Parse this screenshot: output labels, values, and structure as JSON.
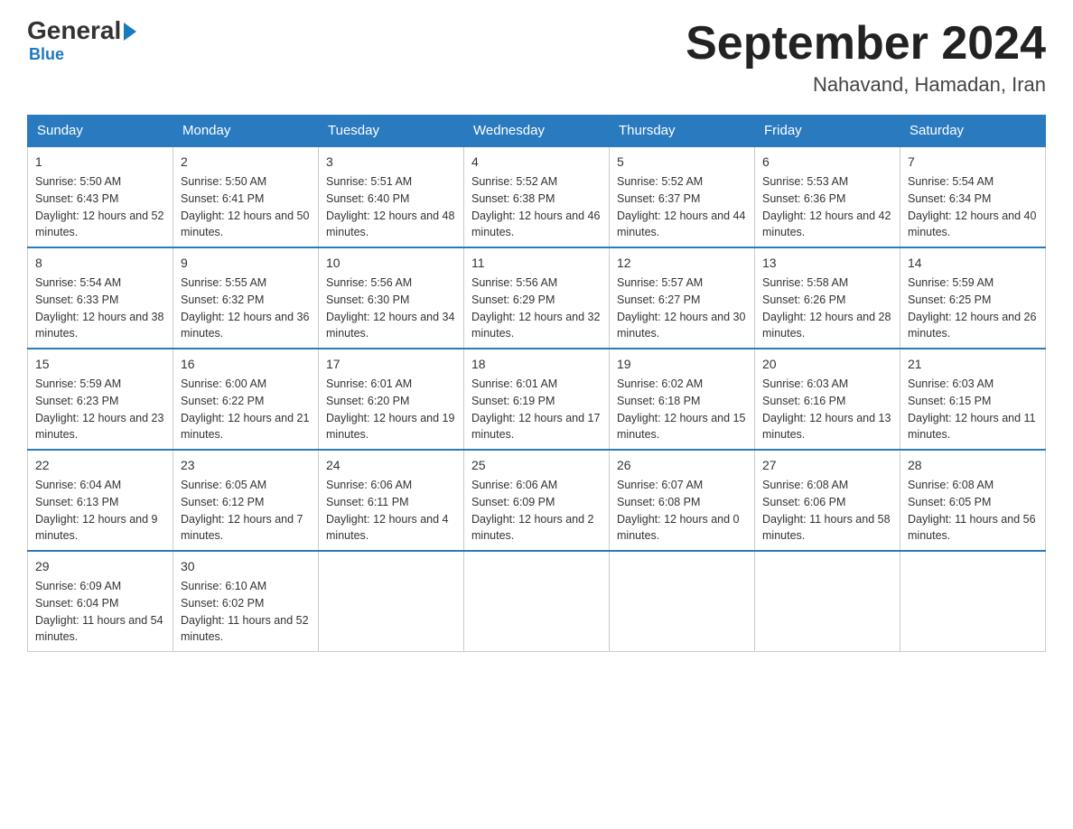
{
  "logo": {
    "general": "General",
    "blue": "Blue",
    "subtitle": "Blue"
  },
  "title": {
    "month_year": "September 2024",
    "location": "Nahavand, Hamadan, Iran"
  },
  "days_header": [
    "Sunday",
    "Monday",
    "Tuesday",
    "Wednesday",
    "Thursday",
    "Friday",
    "Saturday"
  ],
  "weeks": [
    [
      {
        "day": "1",
        "sunrise": "Sunrise: 5:50 AM",
        "sunset": "Sunset: 6:43 PM",
        "daylight": "Daylight: 12 hours and 52 minutes."
      },
      {
        "day": "2",
        "sunrise": "Sunrise: 5:50 AM",
        "sunset": "Sunset: 6:41 PM",
        "daylight": "Daylight: 12 hours and 50 minutes."
      },
      {
        "day": "3",
        "sunrise": "Sunrise: 5:51 AM",
        "sunset": "Sunset: 6:40 PM",
        "daylight": "Daylight: 12 hours and 48 minutes."
      },
      {
        "day": "4",
        "sunrise": "Sunrise: 5:52 AM",
        "sunset": "Sunset: 6:38 PM",
        "daylight": "Daylight: 12 hours and 46 minutes."
      },
      {
        "day": "5",
        "sunrise": "Sunrise: 5:52 AM",
        "sunset": "Sunset: 6:37 PM",
        "daylight": "Daylight: 12 hours and 44 minutes."
      },
      {
        "day": "6",
        "sunrise": "Sunrise: 5:53 AM",
        "sunset": "Sunset: 6:36 PM",
        "daylight": "Daylight: 12 hours and 42 minutes."
      },
      {
        "day": "7",
        "sunrise": "Sunrise: 5:54 AM",
        "sunset": "Sunset: 6:34 PM",
        "daylight": "Daylight: 12 hours and 40 minutes."
      }
    ],
    [
      {
        "day": "8",
        "sunrise": "Sunrise: 5:54 AM",
        "sunset": "Sunset: 6:33 PM",
        "daylight": "Daylight: 12 hours and 38 minutes."
      },
      {
        "day": "9",
        "sunrise": "Sunrise: 5:55 AM",
        "sunset": "Sunset: 6:32 PM",
        "daylight": "Daylight: 12 hours and 36 minutes."
      },
      {
        "day": "10",
        "sunrise": "Sunrise: 5:56 AM",
        "sunset": "Sunset: 6:30 PM",
        "daylight": "Daylight: 12 hours and 34 minutes."
      },
      {
        "day": "11",
        "sunrise": "Sunrise: 5:56 AM",
        "sunset": "Sunset: 6:29 PM",
        "daylight": "Daylight: 12 hours and 32 minutes."
      },
      {
        "day": "12",
        "sunrise": "Sunrise: 5:57 AM",
        "sunset": "Sunset: 6:27 PM",
        "daylight": "Daylight: 12 hours and 30 minutes."
      },
      {
        "day": "13",
        "sunrise": "Sunrise: 5:58 AM",
        "sunset": "Sunset: 6:26 PM",
        "daylight": "Daylight: 12 hours and 28 minutes."
      },
      {
        "day": "14",
        "sunrise": "Sunrise: 5:59 AM",
        "sunset": "Sunset: 6:25 PM",
        "daylight": "Daylight: 12 hours and 26 minutes."
      }
    ],
    [
      {
        "day": "15",
        "sunrise": "Sunrise: 5:59 AM",
        "sunset": "Sunset: 6:23 PM",
        "daylight": "Daylight: 12 hours and 23 minutes."
      },
      {
        "day": "16",
        "sunrise": "Sunrise: 6:00 AM",
        "sunset": "Sunset: 6:22 PM",
        "daylight": "Daylight: 12 hours and 21 minutes."
      },
      {
        "day": "17",
        "sunrise": "Sunrise: 6:01 AM",
        "sunset": "Sunset: 6:20 PM",
        "daylight": "Daylight: 12 hours and 19 minutes."
      },
      {
        "day": "18",
        "sunrise": "Sunrise: 6:01 AM",
        "sunset": "Sunset: 6:19 PM",
        "daylight": "Daylight: 12 hours and 17 minutes."
      },
      {
        "day": "19",
        "sunrise": "Sunrise: 6:02 AM",
        "sunset": "Sunset: 6:18 PM",
        "daylight": "Daylight: 12 hours and 15 minutes."
      },
      {
        "day": "20",
        "sunrise": "Sunrise: 6:03 AM",
        "sunset": "Sunset: 6:16 PM",
        "daylight": "Daylight: 12 hours and 13 minutes."
      },
      {
        "day": "21",
        "sunrise": "Sunrise: 6:03 AM",
        "sunset": "Sunset: 6:15 PM",
        "daylight": "Daylight: 12 hours and 11 minutes."
      }
    ],
    [
      {
        "day": "22",
        "sunrise": "Sunrise: 6:04 AM",
        "sunset": "Sunset: 6:13 PM",
        "daylight": "Daylight: 12 hours and 9 minutes."
      },
      {
        "day": "23",
        "sunrise": "Sunrise: 6:05 AM",
        "sunset": "Sunset: 6:12 PM",
        "daylight": "Daylight: 12 hours and 7 minutes."
      },
      {
        "day": "24",
        "sunrise": "Sunrise: 6:06 AM",
        "sunset": "Sunset: 6:11 PM",
        "daylight": "Daylight: 12 hours and 4 minutes."
      },
      {
        "day": "25",
        "sunrise": "Sunrise: 6:06 AM",
        "sunset": "Sunset: 6:09 PM",
        "daylight": "Daylight: 12 hours and 2 minutes."
      },
      {
        "day": "26",
        "sunrise": "Sunrise: 6:07 AM",
        "sunset": "Sunset: 6:08 PM",
        "daylight": "Daylight: 12 hours and 0 minutes."
      },
      {
        "day": "27",
        "sunrise": "Sunrise: 6:08 AM",
        "sunset": "Sunset: 6:06 PM",
        "daylight": "Daylight: 11 hours and 58 minutes."
      },
      {
        "day": "28",
        "sunrise": "Sunrise: 6:08 AM",
        "sunset": "Sunset: 6:05 PM",
        "daylight": "Daylight: 11 hours and 56 minutes."
      }
    ],
    [
      {
        "day": "29",
        "sunrise": "Sunrise: 6:09 AM",
        "sunset": "Sunset: 6:04 PM",
        "daylight": "Daylight: 11 hours and 54 minutes."
      },
      {
        "day": "30",
        "sunrise": "Sunrise: 6:10 AM",
        "sunset": "Sunset: 6:02 PM",
        "daylight": "Daylight: 11 hours and 52 minutes."
      },
      null,
      null,
      null,
      null,
      null
    ]
  ]
}
